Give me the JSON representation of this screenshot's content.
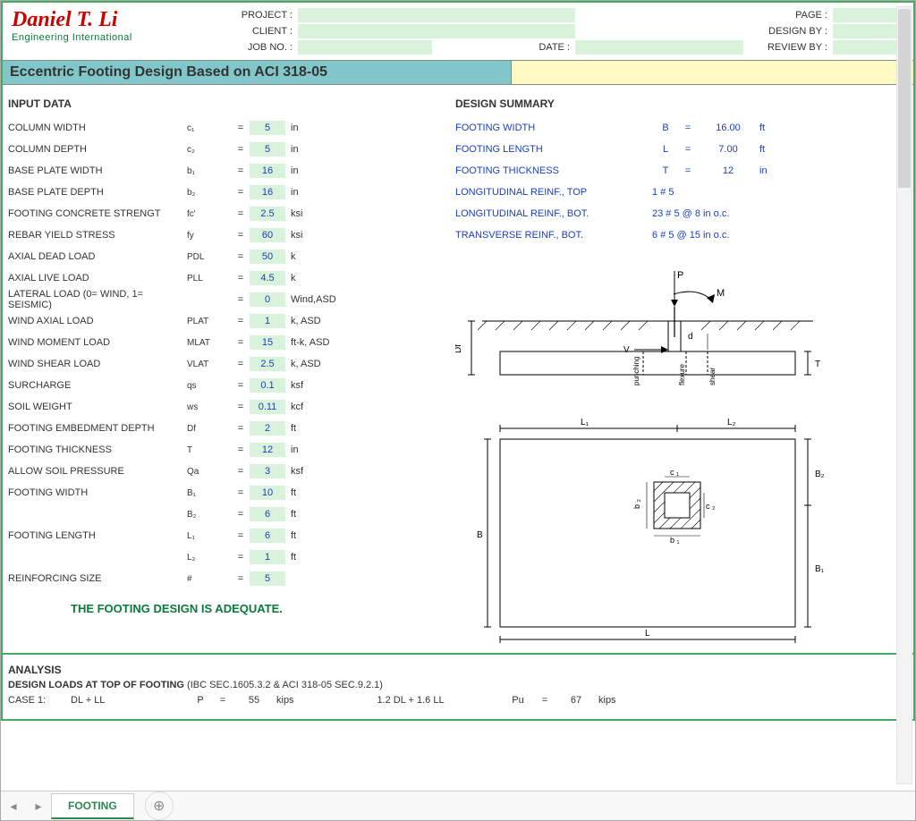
{
  "logo": {
    "name": "Daniel T. Li",
    "subtitle": "Engineering International"
  },
  "header": {
    "project_lbl": "PROJECT :",
    "client_lbl": "CLIENT :",
    "jobno_lbl": "JOB NO. :",
    "date_lbl": "DATE :",
    "page_lbl": "PAGE :",
    "designby_lbl": "DESIGN BY :",
    "reviewby_lbl": "REVIEW BY :"
  },
  "title": "Eccentric Footing Design Based on ACI 318-05",
  "input_head": "INPUT DATA",
  "inputs": [
    {
      "label": "COLUMN WIDTH",
      "sym": "c₁",
      "val": "5",
      "unit": "in"
    },
    {
      "label": "COLUMN DEPTH",
      "sym": "c₂",
      "val": "5",
      "unit": "in"
    },
    {
      "label": "BASE PLATE WIDTH",
      "sym": "b₁",
      "val": "16",
      "unit": "in"
    },
    {
      "label": "BASE PLATE DEPTH",
      "sym": "b₂",
      "val": "16",
      "unit": "in"
    },
    {
      "label": "FOOTING CONCRETE STRENGT",
      "sym": "fc'",
      "val": "2.5",
      "unit": "ksi"
    },
    {
      "label": "REBAR YIELD STRESS",
      "sym": "fy",
      "val": "60",
      "unit": "ksi"
    },
    {
      "label": "AXIAL DEAD LOAD",
      "sym": "PDL",
      "val": "50",
      "unit": "k"
    },
    {
      "label": "AXIAL LIVE LOAD",
      "sym": "PLL",
      "val": "4.5",
      "unit": "k"
    },
    {
      "label": "LATERAL LOAD (0= WIND, 1= SEISMIC)",
      "sym": "",
      "val": "0",
      "unit": "Wind,ASD"
    },
    {
      "label": "WIND AXIAL LOAD",
      "sym": "PLAT",
      "val": "1",
      "unit": "k, ASD"
    },
    {
      "label": "WIND MOMENT LOAD",
      "sym": "MLAT",
      "val": "15",
      "unit": "ft-k, ASD"
    },
    {
      "label": "WIND SHEAR LOAD",
      "sym": "VLAT",
      "val": "2.5",
      "unit": "k, ASD"
    },
    {
      "label": "SURCHARGE",
      "sym": "qs",
      "val": "0.1",
      "unit": "ksf"
    },
    {
      "label": "SOIL WEIGHT",
      "sym": "ws",
      "val": "0.11",
      "unit": "kcf"
    },
    {
      "label": "FOOTING EMBEDMENT DEPTH",
      "sym": "Df",
      "val": "2",
      "unit": "ft"
    },
    {
      "label": "FOOTING THICKNESS",
      "sym": "T",
      "val": "12",
      "unit": "in"
    },
    {
      "label": "ALLOW SOIL PRESSURE",
      "sym": "Qa",
      "val": "3",
      "unit": "ksf"
    },
    {
      "label": "FOOTING WIDTH",
      "sym": "B₁",
      "val": "10",
      "unit": "ft"
    },
    {
      "label": "",
      "sym": "B₂",
      "val": "6",
      "unit": "ft"
    },
    {
      "label": "FOOTING LENGTH",
      "sym": "L₁",
      "val": "6",
      "unit": "ft"
    },
    {
      "label": "",
      "sym": "L₂",
      "val": "1",
      "unit": "ft"
    },
    {
      "label": "REINFORCING SIZE",
      "sym": "#",
      "val": "5",
      "unit": ""
    }
  ],
  "adequate": "THE FOOTING DESIGN IS ADEQUATE.",
  "summary_head": "DESIGN SUMMARY",
  "summary": [
    {
      "label": "FOOTING WIDTH",
      "sym": "B",
      "val": "16.00",
      "unit": "ft"
    },
    {
      "label": "FOOTING LENGTH",
      "sym": "L",
      "val": "7.00",
      "unit": "ft"
    },
    {
      "label": "FOOTING THICKNESS",
      "sym": "T",
      "val": "12",
      "unit": "in"
    },
    {
      "label": "LONGITUDINAL REINF., TOP",
      "sym": "",
      "val": "1 # 5",
      "unit": ""
    },
    {
      "label": "LONGITUDINAL REINF., BOT.",
      "sym": "",
      "val": "23 # 5 @ 8 in o.c.",
      "unit": ""
    },
    {
      "label": "TRANSVERSE REINF., BOT.",
      "sym": "",
      "val": "6 # 5 @ 15 in o.c.",
      "unit": ""
    }
  ],
  "diagram": {
    "P": "P",
    "M": "M",
    "V": "V",
    "Df": "Df",
    "d": "d",
    "T": "T",
    "punching": "punching",
    "flexure": "flexure",
    "shear": "shear",
    "L1": "L₁",
    "L2": "L₂",
    "L": "L",
    "B": "B",
    "B1": "B₁",
    "B2": "B₂",
    "c1": "c ₁",
    "c2": "c ₂",
    "b1": "b ₁",
    "b2": "b ₂"
  },
  "analysis": {
    "head": "ANALYSIS",
    "sub": "DESIGN  LOADS AT TOP OF FOOTING",
    "ref": " (IBC SEC.1605.3.2 & ACI 318-05 SEC.9.2.1)",
    "case": {
      "lbl": "CASE 1:",
      "combo1": "DL + LL",
      "sym1": "P",
      "val1": "55",
      "unit1": "kips",
      "combo2": "1.2 DL + 1.6 LL",
      "sym2": "Pu",
      "val2": "67",
      "unit2": "kips"
    }
  },
  "tabs": {
    "active": "FOOTING"
  }
}
